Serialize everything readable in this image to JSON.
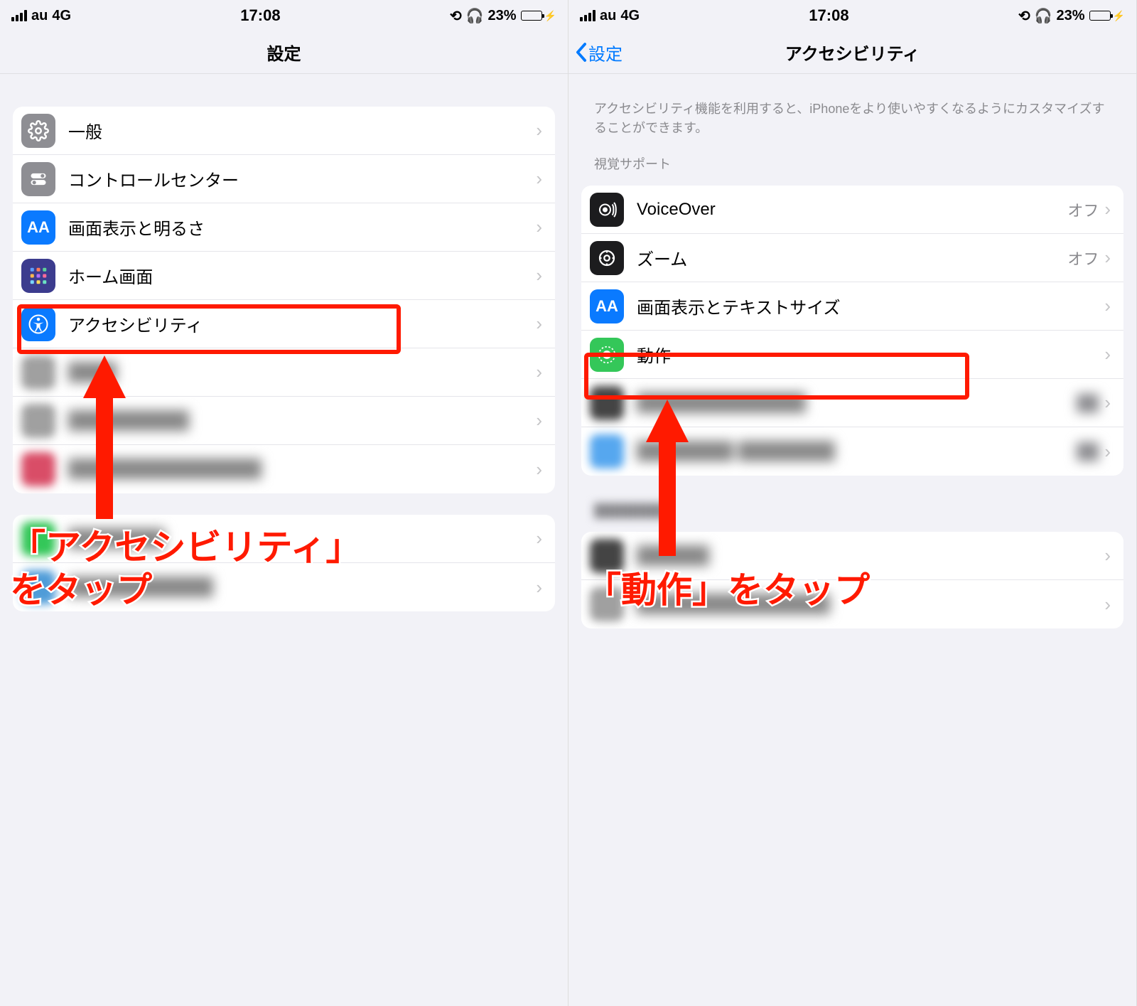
{
  "status": {
    "carrier": "au",
    "network": "4G",
    "time": "17:08",
    "battery_percent": "23%"
  },
  "left": {
    "nav_title": "設定",
    "rows": {
      "general": "一般",
      "control_center": "コントロールセンター",
      "display": "画面表示と明るさ",
      "home": "ホーム画面",
      "accessibility": "アクセシビリティ"
    },
    "caption_line1": "「アクセシビリティ」",
    "caption_line2": "をタップ"
  },
  "right": {
    "nav_back": "設定",
    "nav_title": "アクセシビリティ",
    "description": "アクセシビリティ機能を利用すると、iPhoneをより使いやすくなるようにカスタマイズすることができます。",
    "section_header": "視覚サポート",
    "rows": {
      "voiceover": {
        "label": "VoiceOver",
        "value": "オフ"
      },
      "zoom": {
        "label": "ズーム",
        "value": "オフ"
      },
      "textsize": {
        "label": "画面表示とテキストサイズ"
      },
      "motion": {
        "label": "動作"
      }
    },
    "caption": "「動作」をタップ"
  }
}
